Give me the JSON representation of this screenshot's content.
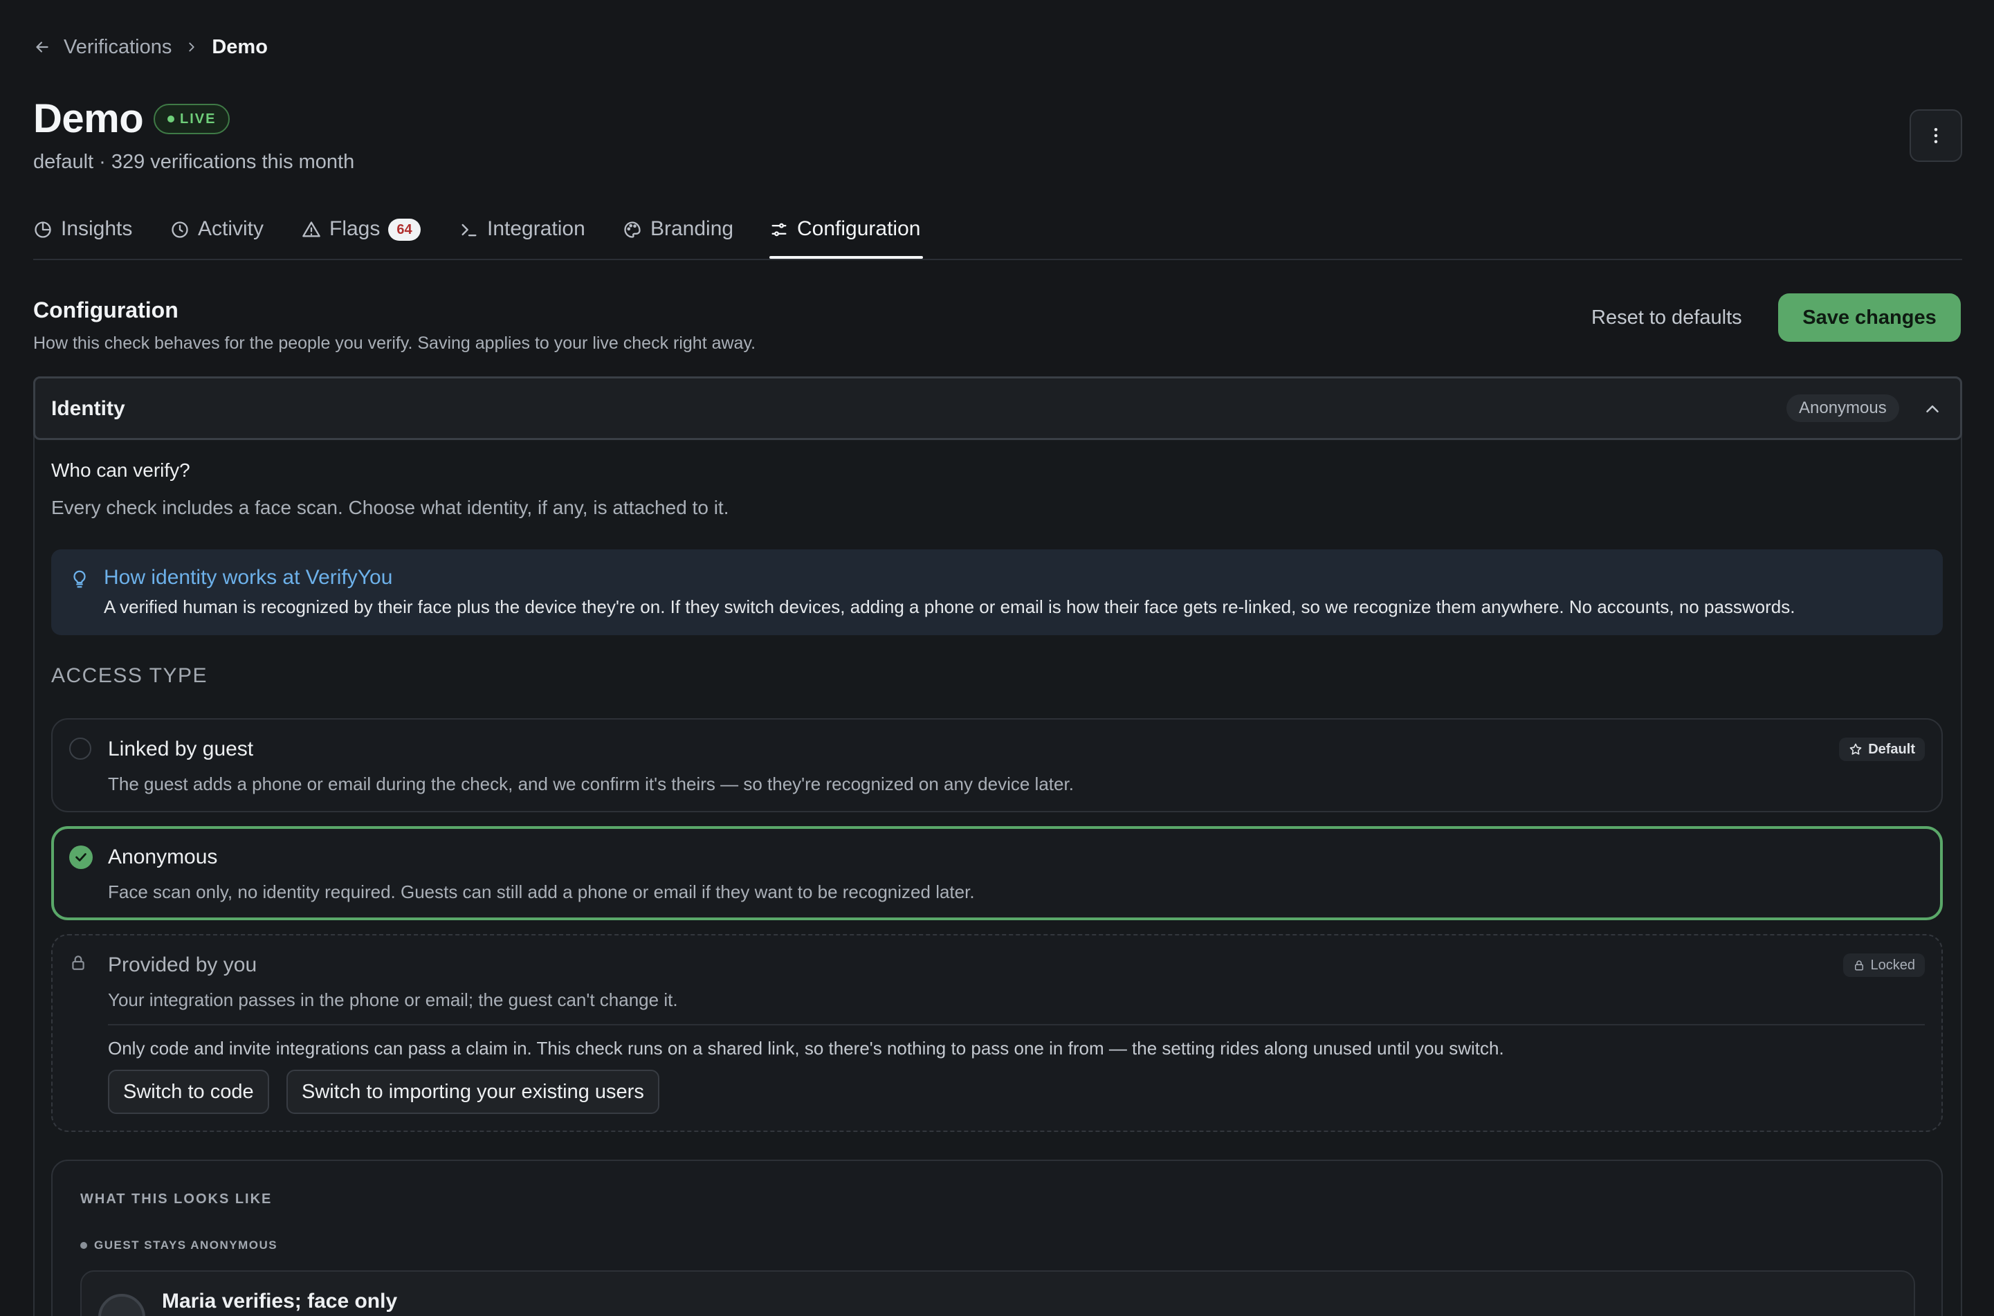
{
  "breadcrumb": {
    "parent": "Verifications",
    "current": "Demo"
  },
  "header": {
    "title": "Demo",
    "status_badge": "LIVE",
    "subtitle": "default · 329 verifications this month"
  },
  "tabs": [
    {
      "label": "Insights",
      "icon": "pie-chart-icon"
    },
    {
      "label": "Activity",
      "icon": "clock-icon"
    },
    {
      "label": "Flags",
      "icon": "warning-triangle-icon",
      "count": "64"
    },
    {
      "label": "Integration",
      "icon": "terminal-icon"
    },
    {
      "label": "Branding",
      "icon": "palette-icon"
    },
    {
      "label": "Configuration",
      "icon": "sliders-icon",
      "active": true
    }
  ],
  "section": {
    "title": "Configuration",
    "description": "How this check behaves for the people you verify. Saving applies to your live check right away.",
    "reset_label": "Reset to defaults",
    "save_label": "Save changes"
  },
  "identity": {
    "title": "Identity",
    "current_value": "Anonymous",
    "question": "Who can verify?",
    "question_desc": "Every check includes a face scan. Choose what identity, if any, is attached to it.",
    "info_title": "How identity works at VerifyYou",
    "info_text": "A verified human is recognized by their face plus the device they're on. If they switch devices, adding a phone or email is how their face gets re-linked, so we recognize them anywhere. No accounts, no passwords.",
    "access_label": "ACCESS TYPE",
    "options": [
      {
        "title": "Linked by guest",
        "desc": "The guest adds a phone or email during the check, and we confirm it's theirs — so they're recognized on any device later.",
        "badge": "Default",
        "state": "unselected"
      },
      {
        "title": "Anonymous",
        "desc": "Face scan only, no identity required. Guests can still add a phone or email if they want to be recognized later.",
        "state": "selected"
      },
      {
        "title": "Provided by you",
        "desc": "Your integration passes in the phone or email; the guest can't change it.",
        "badge": "Locked",
        "state": "locked",
        "note": "Only code and invite integrations can pass a claim in. This check runs on a shared link, so there's nothing to pass one in from — the setting rides along unused until you switch.",
        "buttons": [
          "Switch to code",
          "Switch to importing your existing users"
        ]
      }
    ],
    "preview": {
      "label": "WHAT THIS LOOKS LIKE",
      "scenario": "GUEST STAYS ANONYMOUS",
      "card_title": "Maria verifies; face only"
    }
  },
  "colors": {
    "background": "#15171a",
    "accent_green": "#5aa869",
    "info_blue": "#6db1ea",
    "flag_red": "#b0302f"
  }
}
